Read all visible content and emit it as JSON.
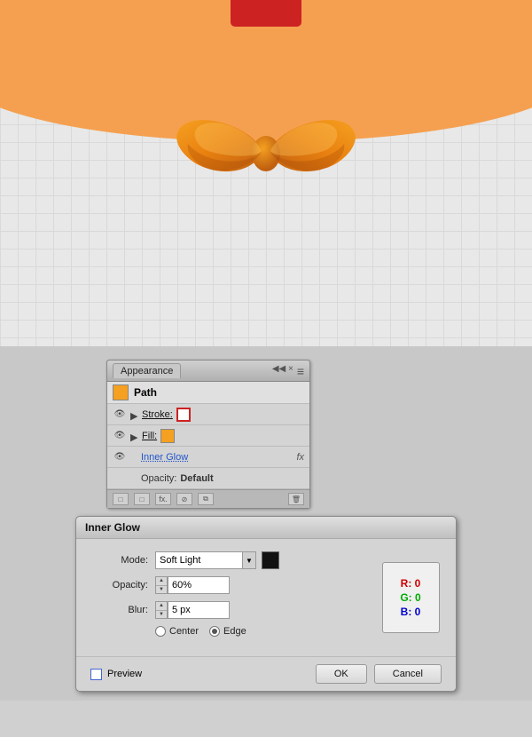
{
  "canvas": {
    "bg_color": "#e0e0e0",
    "orange_color": "#f5a050",
    "red_color": "#cc2222"
  },
  "appearance": {
    "title": "Appearance",
    "panel_controls": "◀◀ ×",
    "menu_icon": "≡",
    "path_label": "Path",
    "stroke_label": "Stroke:",
    "fill_label": "Fill:",
    "inner_glow_label": "Inner Glow",
    "opacity_label": "Opacity:",
    "opacity_value": "Default",
    "footer_icons": [
      "□",
      "□",
      "fx.",
      "⊘",
      "⧉",
      "🗑"
    ]
  },
  "inner_glow": {
    "title": "Inner Glow",
    "mode_label": "Mode:",
    "mode_value": "Soft Light",
    "opacity_label": "Opacity:",
    "opacity_value": "60%",
    "blur_label": "Blur:",
    "blur_value": "5 px",
    "center_label": "Center",
    "edge_label": "Edge",
    "selected_radio": "edge",
    "preview_label": "Preview",
    "ok_label": "OK",
    "cancel_label": "Cancel",
    "rgb_r": "R: 0",
    "rgb_g": "G: 0",
    "rgb_b": "B: 0"
  }
}
